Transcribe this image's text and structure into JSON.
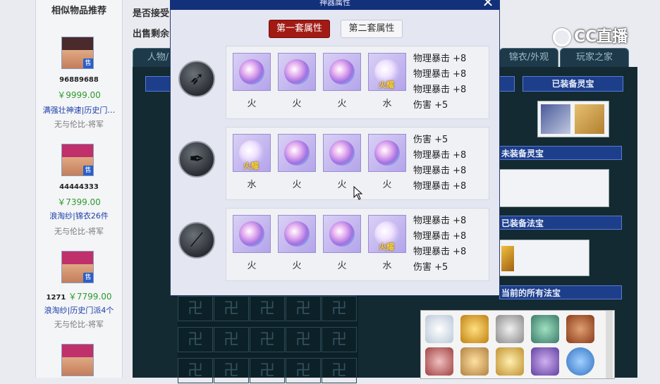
{
  "sidebar": {
    "title": "相似物品推荐",
    "items": [
      {
        "id": "96889688",
        "price": "￥9999.00",
        "name": "满强壮神速|历史门…",
        "desc": "无与伦比-将军"
      },
      {
        "id": "44444333",
        "price": "￥7399.00",
        "name": "浪淘纱|锦衣26件",
        "desc": "无与伦比-将军"
      },
      {
        "id": "1271",
        "price": "￥7799.00",
        "name": "浪淘纱|历史门派4个",
        "desc": "无与伦比-将军"
      }
    ]
  },
  "page": {
    "line1": "是否接受",
    "line2": "出售剩余",
    "tabs": [
      "人物/",
      "锦衣/外观",
      "玩家之家"
    ],
    "box_titles": [
      "已装备灵宝",
      "未装备灵宝",
      "已装备法宝",
      "当前的所有法宝"
    ]
  },
  "modal": {
    "title": "神器属性",
    "close": "✕",
    "btn_set1": "第一套属性",
    "btn_set2": "第二套属性",
    "rows": [
      {
        "icon": "bird-icon",
        "gems": [
          {
            "label": "火",
            "badge": ""
          },
          {
            "label": "火",
            "badge": ""
          },
          {
            "label": "火",
            "badge": ""
          },
          {
            "label": "水",
            "badge": "火耀"
          }
        ],
        "stats": [
          "物理暴击 +8",
          "物理暴击 +8",
          "物理暴击 +8",
          "伤害 +5"
        ]
      },
      {
        "icon": "feather-icon",
        "gems": [
          {
            "label": "水",
            "badge": "火耀"
          },
          {
            "label": "火",
            "badge": ""
          },
          {
            "label": "火",
            "badge": ""
          },
          {
            "label": "火",
            "badge": ""
          }
        ],
        "stats": [
          "伤害 +5",
          "物理暴击 +8",
          "物理暴击 +8",
          "物理暴击 +8"
        ]
      },
      {
        "icon": "dagger-icon",
        "gems": [
          {
            "label": "火",
            "badge": ""
          },
          {
            "label": "火",
            "badge": ""
          },
          {
            "label": "火",
            "badge": ""
          },
          {
            "label": "水",
            "badge": "火耀"
          }
        ],
        "stats": [
          "物理暴击 +8",
          "物理暴击 +8",
          "物理暴击 +8",
          "伤害 +5"
        ]
      }
    ]
  },
  "watermark": "CC直播",
  "colors": {
    "accent_red": "#a21a14",
    "price_green": "#2e9a2e",
    "link_blue": "#1a3ca8",
    "panel_dark": "#132a33"
  }
}
